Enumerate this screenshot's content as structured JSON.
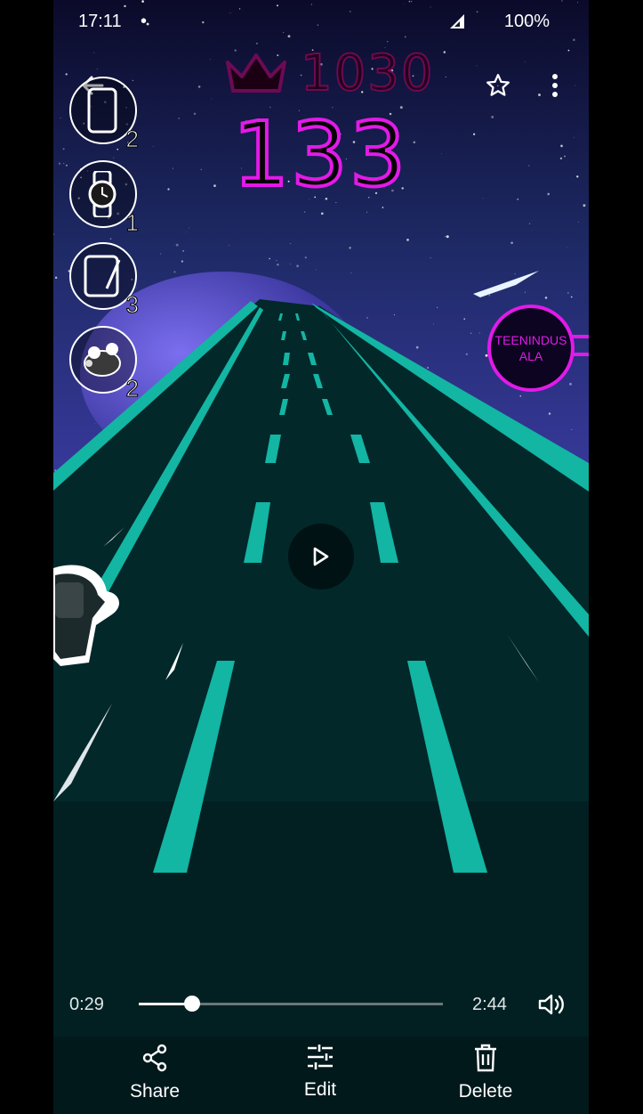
{
  "status_bar": {
    "time": "17:11",
    "dot": "•",
    "battery": "100%"
  },
  "game": {
    "best_score": "1030",
    "current_score": "133",
    "sign_label": "TEENINDUS ALA",
    "device_counts": [
      {
        "icon": "phone-icon",
        "count": "2"
      },
      {
        "icon": "watch-icon",
        "count": "1"
      },
      {
        "icon": "tablet-icon",
        "count": "3"
      },
      {
        "icon": "earbuds-icon",
        "count": "2"
      }
    ]
  },
  "player": {
    "elapsed": "0:29",
    "total": "2:44",
    "progress_fraction": 0.176
  },
  "actions": {
    "share_label": "Share",
    "edit_label": "Edit",
    "delete_label": "Delete"
  },
  "icons": {
    "back": "back-arrow-icon",
    "star": "star-outline-icon",
    "more": "more-vert-icon",
    "play": "play-icon",
    "volume": "volume-icon",
    "crown": "crown-icon"
  },
  "colors": {
    "accent_magenta": "#e21ae8",
    "road_teal": "#14b8a6",
    "background": "#02191c"
  }
}
